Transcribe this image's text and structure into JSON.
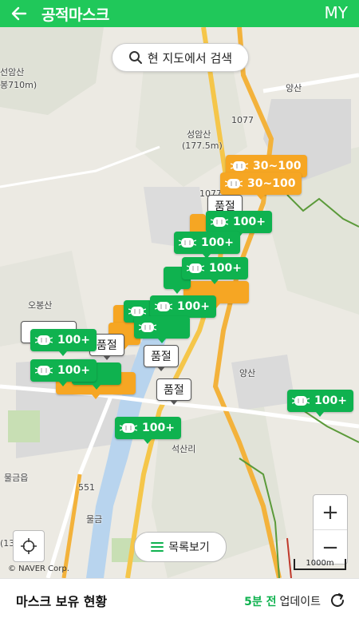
{
  "header": {
    "title": "공적마스크",
    "right": "MY"
  },
  "search": {
    "label": "현 지도에서 검색"
  },
  "map_labels": {
    "seonamsan": "선암산",
    "seonamsan_height": "봉710m)",
    "seongamsan": "성암산",
    "seongamsan_height": "(177.5m)",
    "ic_yangsan": "양산",
    "jc_yangsan": "양산",
    "road_1077": "1077",
    "road_1077b": "1077",
    "road_551": "551",
    "ocbongsan": "오봉산",
    "mulgeumeup": "물금읍",
    "ic_mulgeum": "물금",
    "seoksanri": "석산리",
    "left_13": "(13"
  },
  "markers": [
    {
      "color": "orange",
      "text": "30~100"
    },
    {
      "color": "orange",
      "text": "30~100"
    },
    {
      "color": "white",
      "text": "품절"
    },
    {
      "color": "green",
      "text": "100+"
    },
    {
      "color": "green",
      "text": "100+"
    },
    {
      "color": "green",
      "text": "100+"
    },
    {
      "color": "green",
      "text": "100+"
    },
    {
      "color": "green",
      "text": "100+"
    },
    {
      "color": "white",
      "text": "품절"
    },
    {
      "color": "green",
      "text": "100+"
    },
    {
      "color": "green",
      "text": "100+"
    },
    {
      "color": "white",
      "text": "품절"
    },
    {
      "color": "green",
      "text": "100+"
    },
    {
      "color": "green",
      "text": "100+"
    },
    {
      "color": "green",
      "text": "100+"
    },
    {
      "color": "white",
      "text": "품절"
    },
    {
      "color": "green",
      "text": "100+"
    },
    {
      "color": "green",
      "text": "100+"
    }
  ],
  "controls": {
    "zoom_in": "+",
    "zoom_out": "−",
    "list_label": "목록보기",
    "copyright": "© NAVER Corp.",
    "scale": "1000m"
  },
  "footer": {
    "title": "마스크 보유 현황",
    "ago": "5분 전",
    "update_label": "업데이트"
  },
  "colors": {
    "brand": "#20c85a",
    "green_marker": "#0fb24f",
    "orange_marker": "#f6a623"
  }
}
